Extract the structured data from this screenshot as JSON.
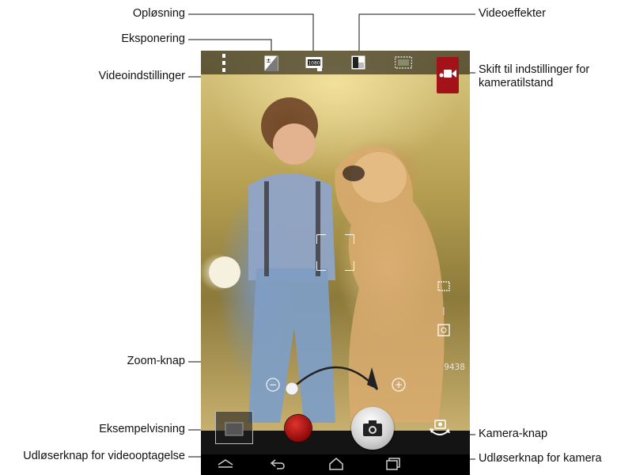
{
  "labels": {
    "resolution": "Opløsning",
    "exposure": "Eksponering",
    "video_settings": "Videoindstillinger",
    "video_effects": "Videoeffekter",
    "switch_camera_line1": "Skift til indstillinger for",
    "switch_camera_line2": "kameratilstand",
    "zoom": "Zoom-knap",
    "preview": "Eksempelvisning",
    "video_shutter": "Udløserknap for videooptagelse",
    "camera_button": "Kamera-knap",
    "camera_shutter": "Udløserknap for kamera"
  },
  "screen": {
    "shot_counter": "9438",
    "zoom_minus": "−",
    "zoom_plus": "+",
    "resolution_badge": "1080"
  },
  "icons": {
    "video_settings": "dots-menu-icon",
    "exposure": "exposure-icon",
    "resolution": "resolution-1080-icon",
    "effects": "effects-icon",
    "panorama": "film-icon",
    "camera_mode": "camera-mode-icon",
    "back": "back-icon",
    "home": "home-icon",
    "recents": "recents-icon"
  },
  "colors": {
    "camera_mode_bg": "#a31218",
    "record_button": "#b01414",
    "shutter_button": "#d3d3d3"
  }
}
